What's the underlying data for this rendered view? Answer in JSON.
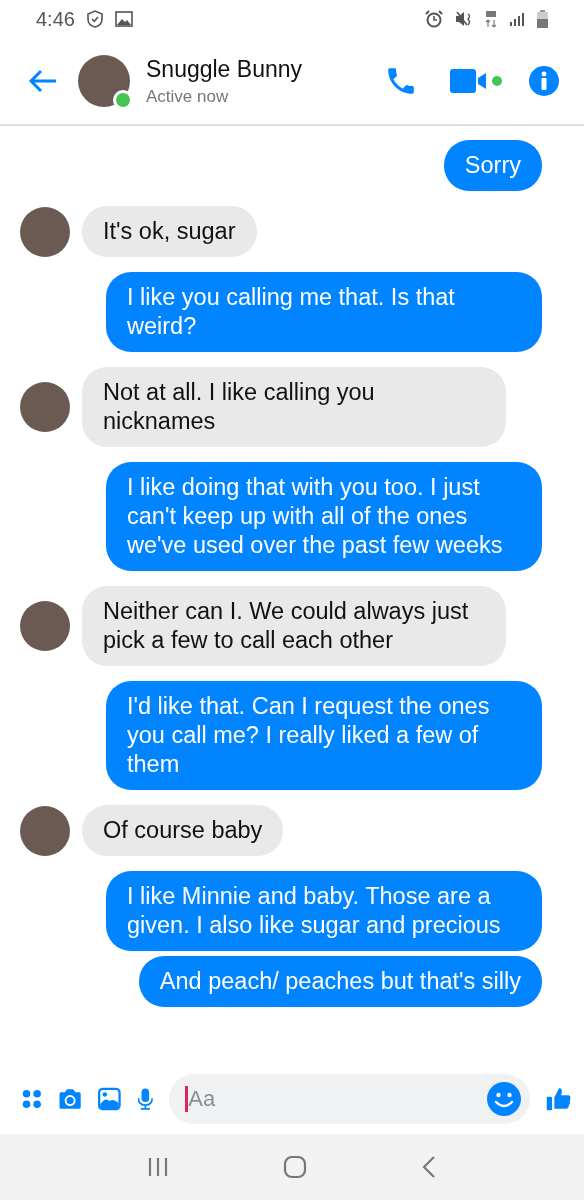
{
  "status_bar": {
    "time": "4:46"
  },
  "header": {
    "name": "Snuggle Bunny",
    "status": "Active now",
    "active": true
  },
  "messages": [
    {
      "kind": "sent",
      "text": "Sorry"
    },
    {
      "kind": "received",
      "text": "It's ok, sugar"
    },
    {
      "kind": "sent",
      "text": "I like you calling me that. Is that weird?"
    },
    {
      "kind": "received",
      "text": "Not at all. I like calling you nicknames"
    },
    {
      "kind": "sent",
      "text": "I like doing that with you too. I just can't keep up with all of the ones we've used over the past few weeks"
    },
    {
      "kind": "received",
      "text": "Neither can I. We could always just pick a few to call each other"
    },
    {
      "kind": "sent",
      "text": "I'd like that. Can I request the ones you call me? I really liked a few of them"
    },
    {
      "kind": "received",
      "text": "Of course baby"
    },
    {
      "kind": "sent",
      "text": "I like Minnie and baby. Those are a given.  I also like sugar and precious"
    },
    {
      "kind": "sent",
      "text": "And peach/ peaches but that's silly"
    }
  ],
  "composer": {
    "placeholder": "Aa"
  }
}
